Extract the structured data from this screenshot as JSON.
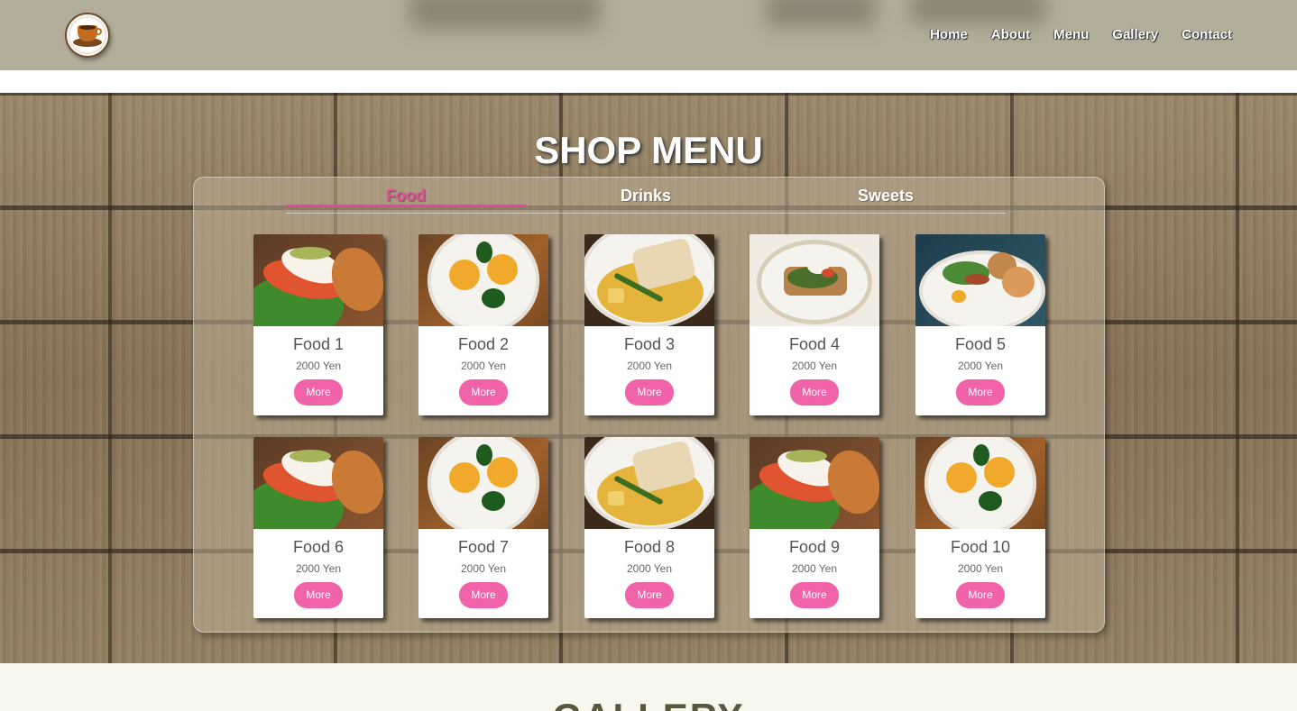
{
  "nav": {
    "logo_icon": "coffee-cup-icon",
    "links": [
      "Home",
      "About",
      "Menu",
      "Gallery",
      "Contact"
    ]
  },
  "menu": {
    "title": "SHOP MENU",
    "tabs": [
      {
        "label": "Food",
        "active": true
      },
      {
        "label": "Drinks",
        "active": false
      },
      {
        "label": "Sweets",
        "active": false
      }
    ],
    "accent_color": "#f062a9",
    "items": [
      {
        "name": "Food 1",
        "price": "2000 Yen",
        "button": "More",
        "image": "salmon-toast"
      },
      {
        "name": "Food 2",
        "price": "2000 Yen",
        "button": "More",
        "image": "eggs-benedict"
      },
      {
        "name": "Food 3",
        "price": "2000 Yen",
        "button": "More",
        "image": "fish-curry"
      },
      {
        "name": "Food 4",
        "price": "2000 Yen",
        "button": "More",
        "image": "avocado-toast"
      },
      {
        "name": "Food 5",
        "price": "2000 Yen",
        "button": "More",
        "image": "breakfast-plate"
      },
      {
        "name": "Food 6",
        "price": "2000 Yen",
        "button": "More",
        "image": "salmon-toast"
      },
      {
        "name": "Food 7",
        "price": "2000 Yen",
        "button": "More",
        "image": "eggs-benedict"
      },
      {
        "name": "Food 8",
        "price": "2000 Yen",
        "button": "More",
        "image": "fish-curry"
      },
      {
        "name": "Food 9",
        "price": "2000 Yen",
        "button": "More",
        "image": "salmon-toast"
      },
      {
        "name": "Food 10",
        "price": "2000 Yen",
        "button": "More",
        "image": "eggs-benedict"
      }
    ]
  },
  "gallery": {
    "title": "GALLERY"
  }
}
